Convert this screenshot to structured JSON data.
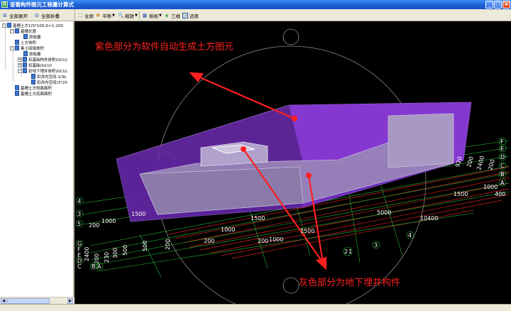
{
  "window": {
    "title": "查看构件图元工程量计算式",
    "minimize": "_",
    "maximize": "□",
    "close": "×"
  },
  "tree_toolbar": {
    "expand_all": "全部展开",
    "collapse_all": "全部折叠"
  },
  "view_toolbar": {
    "fullscreen": "全屏",
    "pan": "平移",
    "zoom": "缩放",
    "view": "俯视",
    "three_d": "三维",
    "restore": "还原"
  },
  "tree": [
    {
      "label": "基槽土方1(5*100,D<1-100"
    },
    {
      "label": "基槽长度"
    },
    {
      "label": "原始量"
    },
    {
      "label": "土方体积"
    },
    {
      "label": "素土回填体积"
    },
    {
      "label": "原始量"
    },
    {
      "label": "扣基础构件体积(GCU)"
    },
    {
      "label": "扣基础(GCU)"
    },
    {
      "label": "扣地下埋井体积(GCU)"
    },
    {
      "label": "扣井内空间-1(9L"
    },
    {
      "label": "扣井内空间(3*25"
    },
    {
      "label": "基槽土方侧面面积"
    },
    {
      "label": "基槽土方底面面积"
    }
  ],
  "annotations": {
    "top_note": "紫色部分为软件自动生成土方图元",
    "bottom_note": "灰色部分为地下埋井构件",
    "accent_color": "#ff2020",
    "purple_color": "#8a3bd6",
    "gray_color": "#9a88b8"
  },
  "axis_labels": {
    "right_letters": [
      "F",
      "E",
      "D",
      "C",
      "B",
      "A"
    ],
    "right_numbers": [
      "920",
      "200",
      "2400",
      "200",
      "1000",
      "400",
      "1500",
      "10400",
      "5000",
      "1500",
      "1000",
      "200"
    ],
    "left_numbers": [
      "4",
      "3",
      "5",
      "200",
      "1000",
      "1500",
      "200",
      "230",
      "300",
      "500",
      "500",
      "200",
      "2400"
    ],
    "left_letters": [
      "G",
      "F",
      "E",
      "D",
      "C",
      "B",
      "A"
    ],
    "bottom_numbers": [
      "200",
      "1000",
      "1500",
      "3",
      "4",
      "2",
      "1"
    ]
  }
}
